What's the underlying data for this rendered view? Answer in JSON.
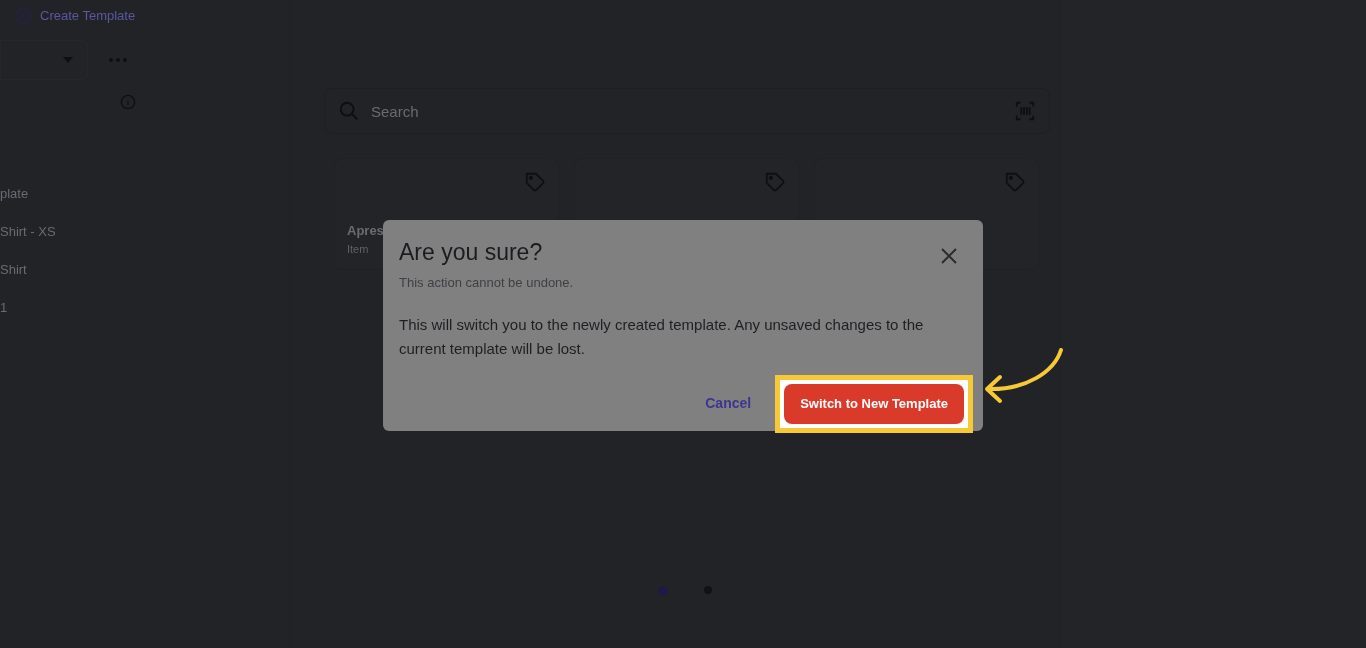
{
  "header": {
    "create_label": "Create Template"
  },
  "sidebar": {
    "items": [
      {
        "label": "plate"
      },
      {
        "label": "Shirt - XS"
      },
      {
        "label": "Shirt"
      },
      {
        "label": "1"
      }
    ]
  },
  "search": {
    "placeholder": "Search"
  },
  "cards": [
    {
      "kind": "item",
      "title": "Apres",
      "subtitle": "Item"
    },
    {
      "kind": "blank"
    },
    {
      "kind": "blank"
    }
  ],
  "pagination": [
    {
      "selected": true
    },
    {
      "selected": false
    }
  ],
  "dialog": {
    "title": "Are you sure?",
    "subtitle": "This action cannot be undone.",
    "body": "This will switch you to the newly created template. Any unsaved changes to the current template will be lost.",
    "cancel": "Cancel",
    "confirm": "Switch to New Template",
    "confirm_highlighted": true
  }
}
